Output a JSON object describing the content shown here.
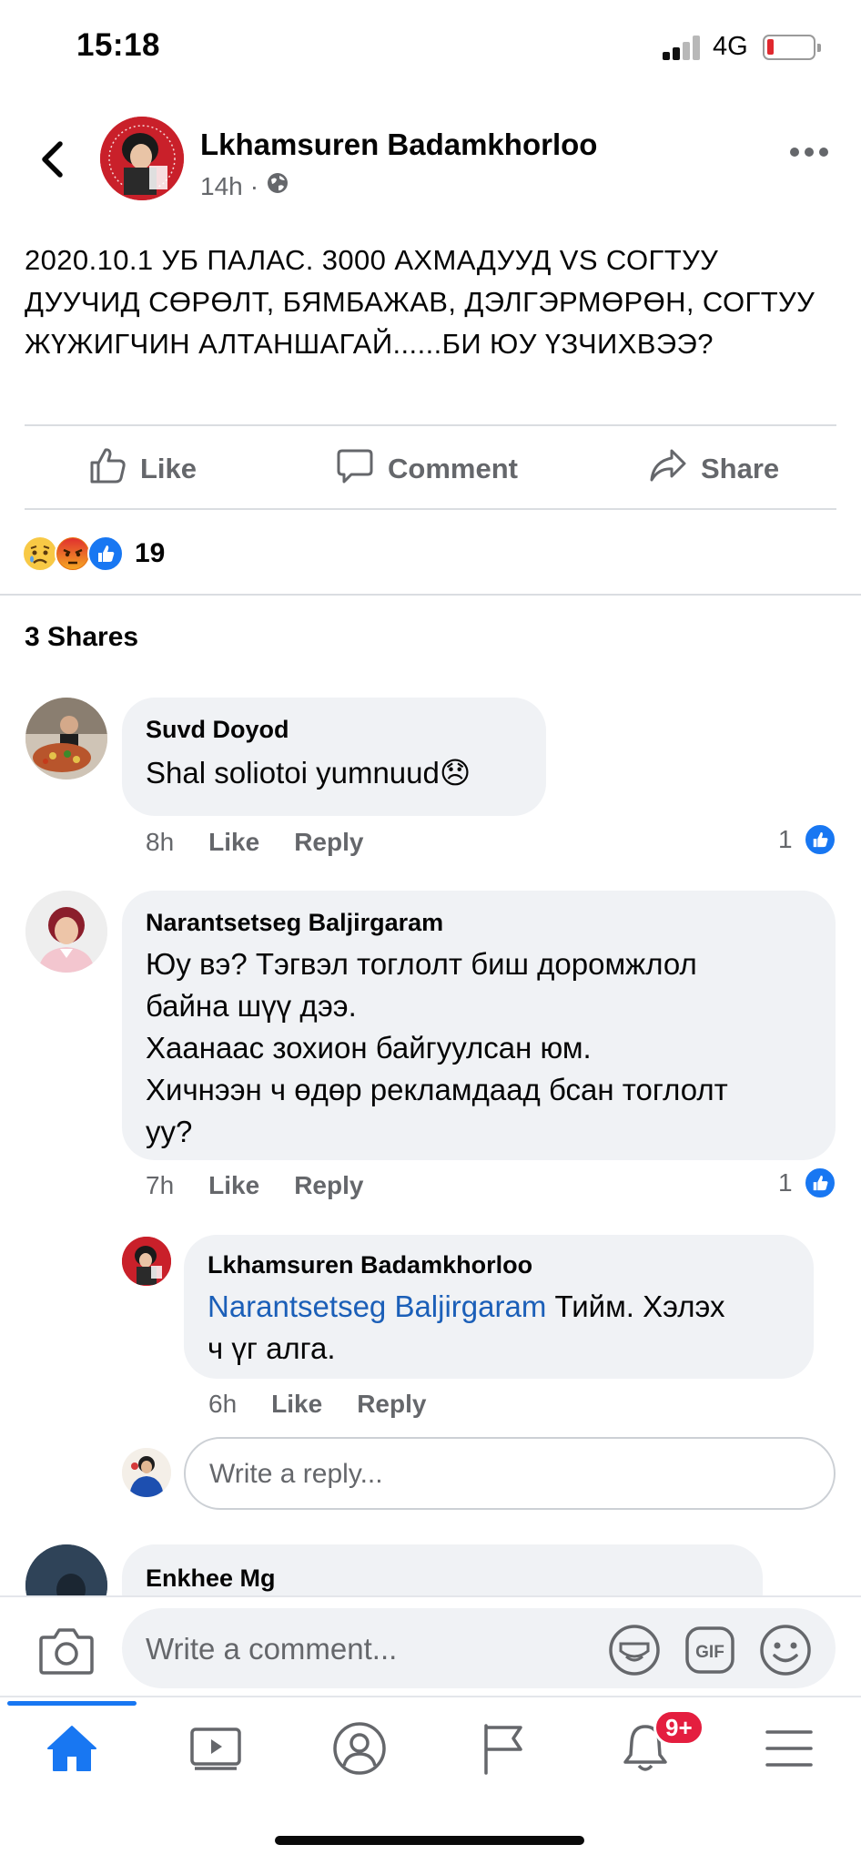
{
  "status_bar": {
    "time": "15:18",
    "network": "4G"
  },
  "post": {
    "author": "Lkhamsuren Badamkhorloo",
    "time": "14h",
    "separator": "·",
    "text": "2020.10.1 УБ ПАЛАС. 3000 АХМАДУУД VS СОГТУУ ДУУЧИД СӨРӨЛТ, БЯМБАЖАВ, ДЭЛГЭРМӨРӨН, СОГТУУ ЖҮЖИГЧИН АЛТАНШАГАЙ......БИ ЮУ ҮЗЧИХВЭЭ?",
    "actions": {
      "like": "Like",
      "comment": "Comment",
      "share": "Share"
    },
    "reaction_count": "19",
    "reaction_icons": [
      "sad-icon",
      "angry-icon",
      "like-icon"
    ],
    "shares": "3 Shares"
  },
  "comments": [
    {
      "name": "Suvd Doyod",
      "text": "Shal soliotoi yumnuud",
      "emoji": "😞",
      "time": "8h",
      "like_label": "Like",
      "reply_label": "Reply",
      "likes": "1"
    },
    {
      "name": "Narantsetseg Baljirgaram",
      "lines": [
        "Юу вэ? Тэгвэл тоглолт биш доромжлол",
        "байна шүү дээ.",
        "Хаанаас зохион байгуулсан юм.",
        "Хичнээн ч өдөр рекламдаад бсан тоглолт",
        "уу?"
      ],
      "time": "7h",
      "like_label": "Like",
      "reply_label": "Reply",
      "likes": "1",
      "reply": {
        "name": "Lkhamsuren Badamkhorloo",
        "mention": "Narantsetseg Baljirgaram",
        "text_line1": " Тийм. Хэлэх",
        "text_line2": "ч үг алга.",
        "time": "6h",
        "like_label": "Like",
        "reply_label": "Reply"
      }
    },
    {
      "name": "Enkhee Mg"
    }
  ],
  "reply_input": {
    "placeholder": "Write a reply..."
  },
  "composer": {
    "placeholder": "Write a comment..."
  },
  "tabs": [
    "home-icon",
    "watch-icon",
    "profile-icon",
    "pages-flag-icon",
    "notifications-bell-icon",
    "menu-icon"
  ],
  "notifications_badge": "9+",
  "colors": {
    "accent": "#1877f2",
    "badge": "#e41e3f",
    "bubble": "#f0f2f5",
    "mention": "#1b5fb8"
  }
}
